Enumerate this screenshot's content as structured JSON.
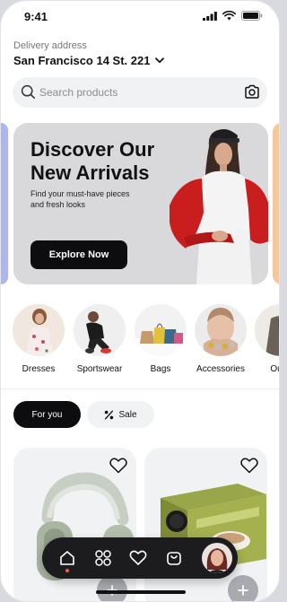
{
  "status": {
    "time": "9:41"
  },
  "delivery": {
    "label": "Delivery address",
    "address": "San Francisco 14 St. 221"
  },
  "search": {
    "placeholder": "Search products"
  },
  "banner": {
    "title_line1": "Discover Our",
    "title_line2": "New Arrivals",
    "subtitle_line1": "Find your must-have pieces",
    "subtitle_line2": "and fresh looks",
    "cta": "Explore Now"
  },
  "categories": [
    {
      "label": "Dresses"
    },
    {
      "label": "Sportswear"
    },
    {
      "label": "Bags"
    },
    {
      "label": "Accessories"
    },
    {
      "label": "Outw"
    }
  ],
  "filters": {
    "for_you": "For you",
    "sale": "Sale"
  },
  "colors": {
    "accent_dark": "#0d0d0f",
    "banner_bg": "#d9d9dc",
    "chip_bg": "#f1f2f4",
    "nav_bg": "#1c1c1e",
    "active_dot": "#ff5a3c"
  },
  "icons": {
    "search": "search-icon",
    "camera": "camera-icon",
    "chevron": "chevron-down-icon",
    "percent": "percent-icon",
    "heart": "heart-icon",
    "plus": "plus-icon",
    "home": "home-icon",
    "grid": "grid-icon",
    "bag": "shopping-bag-icon"
  }
}
